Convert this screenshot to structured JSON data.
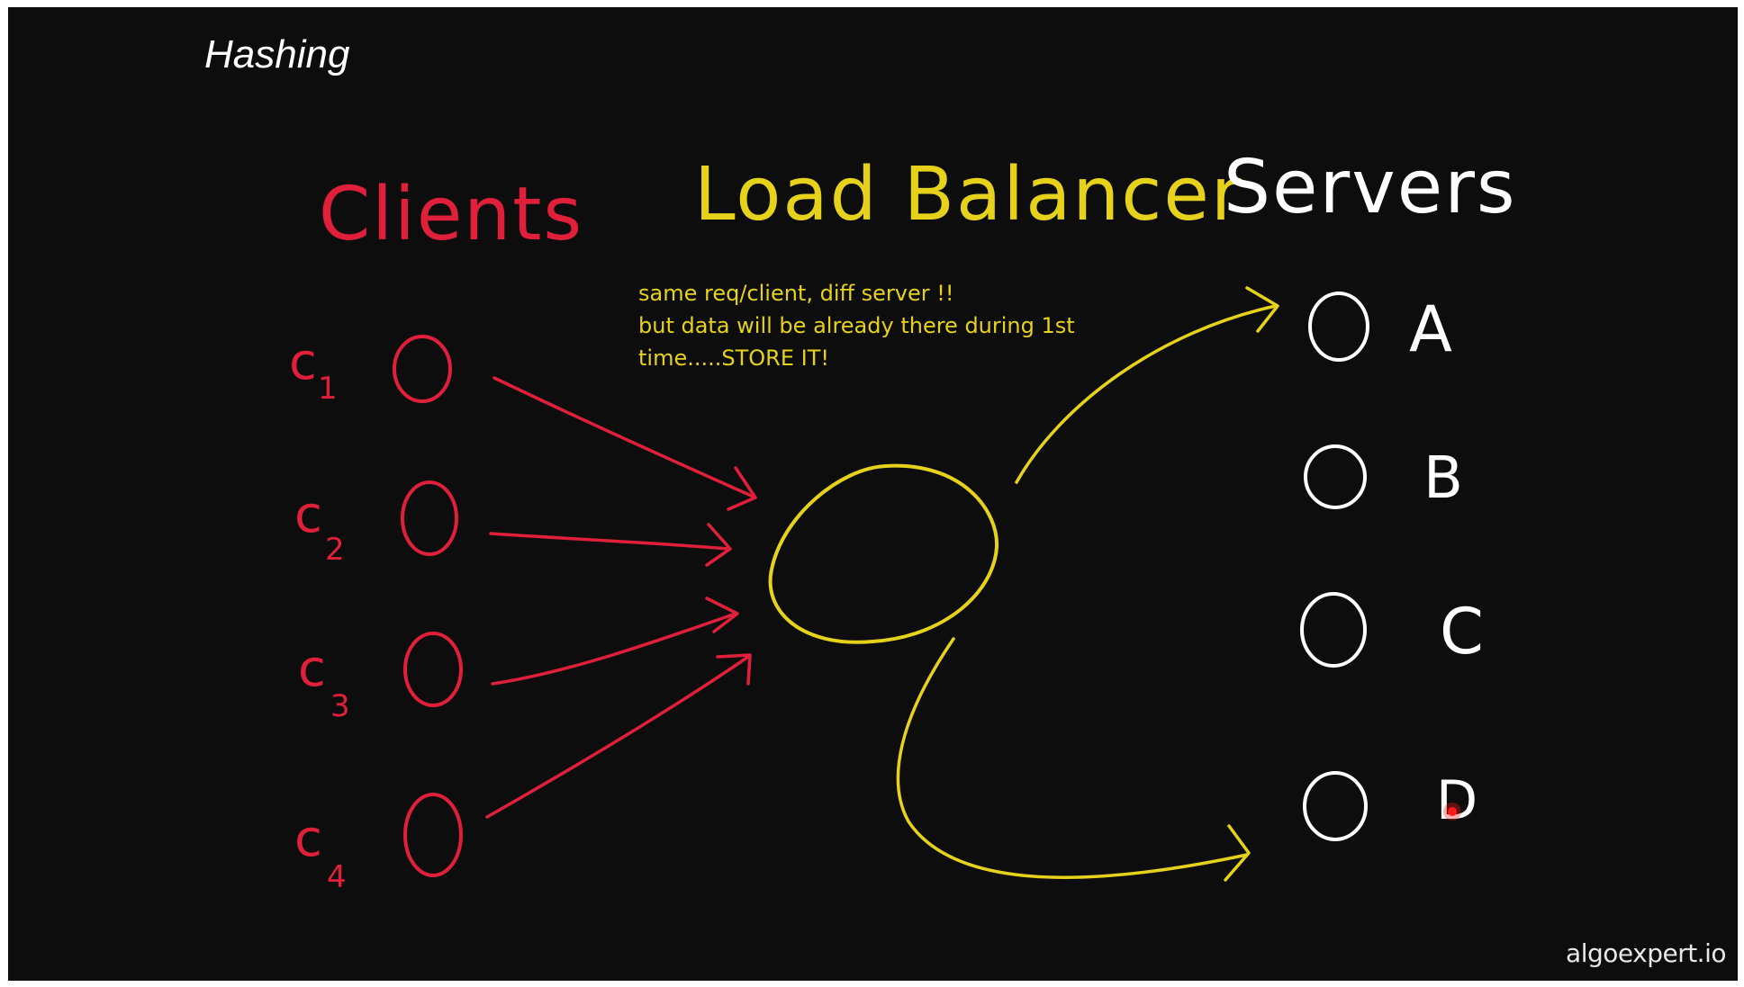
{
  "title": "Hashing",
  "labels": {
    "clients": "Clients",
    "load_balancer": "Load Balancer",
    "servers": "Servers"
  },
  "note": {
    "lines": [
      "same req/client, diff server !!",
      "but data will be already there during 1st",
      "time.....STORE IT!"
    ]
  },
  "clients": [
    {
      "base": "c",
      "sub": "1"
    },
    {
      "base": "c",
      "sub": "2"
    },
    {
      "base": "c",
      "sub": "3"
    },
    {
      "base": "c",
      "sub": "4"
    }
  ],
  "servers": [
    "A",
    "B",
    "C",
    "D"
  ],
  "watermark": "algoexpert.io",
  "colors": {
    "background": "#0d0d0d",
    "clients": "#e0203a",
    "load_balancer": "#e6d21a",
    "servers": "#ffffff",
    "laser": "#ff1a1a"
  }
}
